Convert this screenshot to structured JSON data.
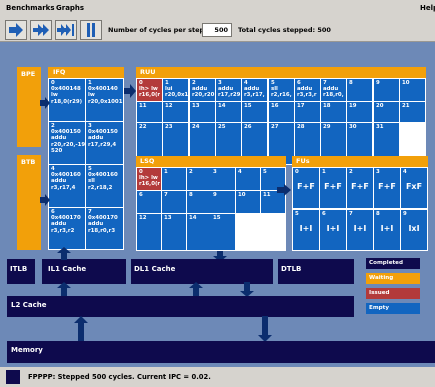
{
  "menu": {
    "benchmarks": "Benchmarks",
    "graphs": "Graphs",
    "help": "Help"
  },
  "toolbar": {
    "cycles_label": "Number of cycles per step:",
    "cycles_value": "500",
    "total_label": "Total cycles stepped: 500"
  },
  "bpe": {
    "label": "BPE"
  },
  "btb": {
    "label": "BTB"
  },
  "ifq": {
    "label": "IFQ",
    "cells": [
      {
        "num": "0",
        "text": "0x400148\nlw\nr18,0(r29)"
      },
      {
        "num": "1",
        "text": "0x400140\nlw\nr20,0x1001"
      },
      {
        "num": "2",
        "text": "0x400150\naddu\nr20,r20,-19\n520"
      },
      {
        "num": "3",
        "text": "0x400150\naddu\nr17,r29,4"
      },
      {
        "num": "4",
        "text": "0x400160\naddu\nr3,r17,4"
      },
      {
        "num": "5",
        "text": "0x400160\nsll\nr2,r18,2"
      },
      {
        "num": "6",
        "text": "0x400170\naddu\nr3,r3,r2"
      },
      {
        "num": "7",
        "text": "0x400170\naddu\nr18,r0,r3"
      }
    ]
  },
  "ruu": {
    "label": "RUU",
    "row0": [
      {
        "num": "0",
        "text": "lh> lw\nr16,0(r",
        "state": "issued"
      },
      {
        "num": "1",
        "text": "lui\nr20,0x1",
        "state": ""
      },
      {
        "num": "2",
        "text": "addu\nr20,r20",
        "state": ""
      },
      {
        "num": "3",
        "text": "addu\nr17,r29",
        "state": ""
      },
      {
        "num": "4",
        "text": "addu\nr3,r17,",
        "state": ""
      },
      {
        "num": "5",
        "text": "sll\nr2,r16,",
        "state": ""
      },
      {
        "num": "6",
        "text": "addu\nr3,r3,r",
        "state": ""
      },
      {
        "num": "7",
        "text": "addu\nr18,r0,",
        "state": ""
      },
      {
        "num": "8",
        "text": "",
        "state": ""
      },
      {
        "num": "9",
        "text": "",
        "state": ""
      },
      {
        "num": "10",
        "text": "",
        "state": ""
      }
    ],
    "row1": [
      "11",
      "12",
      "13",
      "14",
      "15",
      "16",
      "17",
      "18",
      "19",
      "20",
      "21"
    ],
    "row2": [
      "22",
      "23",
      "24",
      "25",
      "26",
      "27",
      "28",
      "29",
      "30",
      "31"
    ]
  },
  "lsq": {
    "label": "LSQ",
    "row0": [
      {
        "num": "0",
        "text": "lh> lw\nr16,0(r",
        "state": "issued"
      },
      {
        "num": "1",
        "text": "",
        "state": ""
      },
      {
        "num": "2",
        "text": "",
        "state": ""
      },
      {
        "num": "3",
        "text": "",
        "state": ""
      },
      {
        "num": "4",
        "text": "",
        "state": ""
      },
      {
        "num": "5",
        "text": "",
        "state": ""
      }
    ],
    "row1": [
      "6",
      "7",
      "8",
      "9",
      "10",
      "11"
    ],
    "row2": [
      "12",
      "13",
      "14",
      "15"
    ]
  },
  "fus": {
    "label": "FUs",
    "units": [
      {
        "num": "0",
        "op": "F+F"
      },
      {
        "num": "1",
        "op": "F+F"
      },
      {
        "num": "2",
        "op": "F+F"
      },
      {
        "num": "3",
        "op": "F+F"
      },
      {
        "num": "4",
        "op": "FxF"
      },
      {
        "num": "5",
        "op": "I+I"
      },
      {
        "num": "6",
        "op": "I+I"
      },
      {
        "num": "7",
        "op": "I+I"
      },
      {
        "num": "8",
        "op": "I+I"
      },
      {
        "num": "9",
        "op": "IxI"
      }
    ]
  },
  "caches": {
    "itlb": "ITLB",
    "il1": "IL1 Cache",
    "dl1": "DL1 Cache",
    "dtlb": "DTLB",
    "l2": "L2 Cache",
    "memory": "Memory"
  },
  "legend": {
    "completed": {
      "label": "Completed",
      "color": "#0e0a4d"
    },
    "waiting": {
      "label": "Waiting",
      "color": "#f2a00a"
    },
    "issued": {
      "label": "Issued",
      "color": "#b33a3a"
    },
    "empty": {
      "label": "Empty",
      "color": "#1265c0"
    }
  },
  "status": {
    "text": "FPPPP: Stepped 500 cycles.  Current IPC = 0.02."
  }
}
